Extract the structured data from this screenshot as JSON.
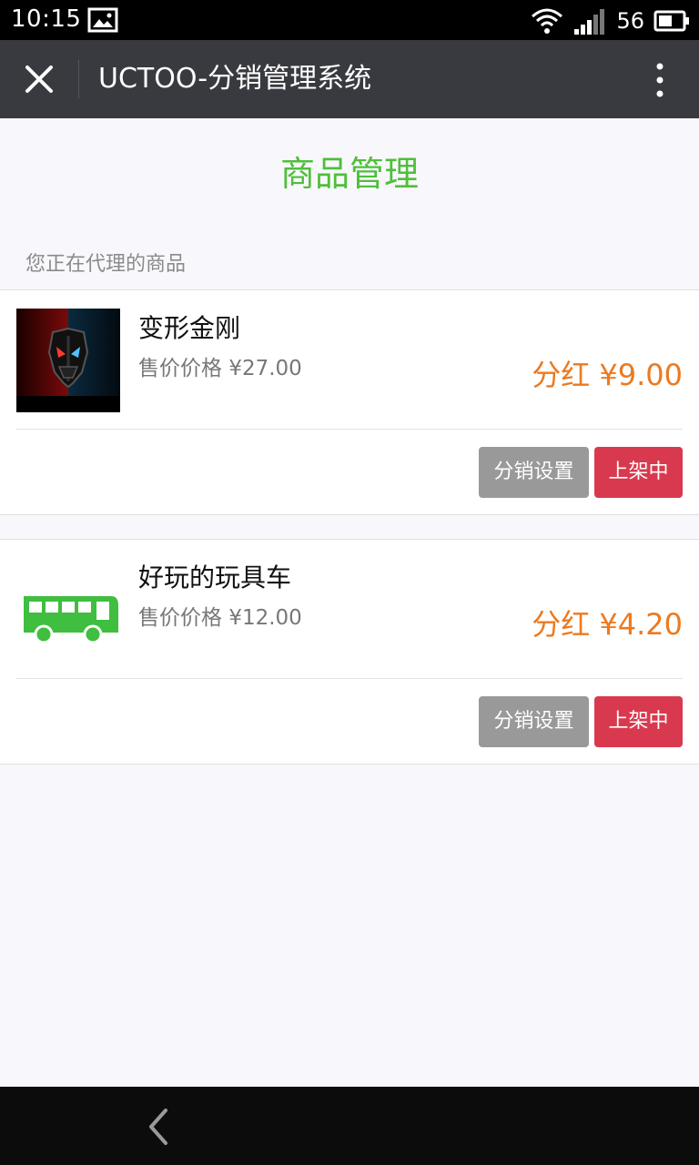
{
  "status_bar": {
    "time": "10:15",
    "signal_text": "56",
    "icons": [
      "image-icon",
      "wifi-icon",
      "signal-icon",
      "battery-icon"
    ]
  },
  "title_bar": {
    "title": "UCTOO-分销管理系统",
    "close_icon": "close-icon",
    "more_icon": "more-vertical-icon"
  },
  "page": {
    "title": "商品管理",
    "section_label": "您正在代理的商品"
  },
  "products": [
    {
      "name": "变形金刚",
      "price_label": "售价价格",
      "price": "¥27.00",
      "bonus_label": "分红",
      "bonus": "¥9.00",
      "thumb": "transformers-logo-image",
      "setting_button": "分销设置",
      "status_button": "上架中"
    },
    {
      "name": "好玩的玩具车",
      "price_label": "售价价格",
      "price": "¥12.00",
      "bonus_label": "分红",
      "bonus": "¥4.20",
      "thumb": "green-bus-image",
      "setting_button": "分销设置",
      "status_button": "上架中"
    }
  ],
  "nav_bar": {
    "back_icon": "back-arrow-icon"
  },
  "colors": {
    "title_green": "#4fbf3a",
    "bonus_orange": "#ec7a1f",
    "setting_gray": "#999999",
    "onshelf_red": "#d9394e",
    "titlebar_bg": "#393a3f"
  }
}
